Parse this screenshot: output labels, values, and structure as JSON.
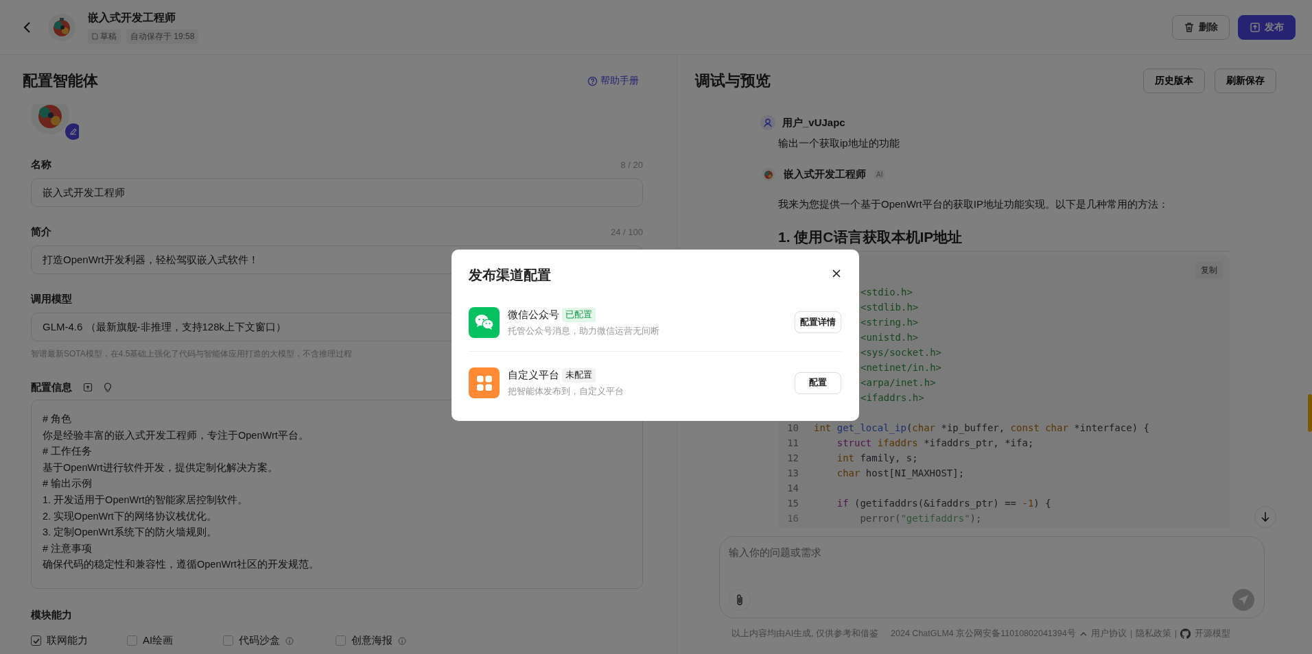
{
  "header": {
    "title": "嵌入式开发工程师",
    "status": "草稿",
    "autosave": "自动保存于 19:58",
    "buttons": [
      {
        "label": "删除",
        "kind": "delete"
      },
      {
        "label": "发布",
        "kind": "publish"
      }
    ]
  },
  "config": {
    "title": "配置智能体",
    "help": "帮助手册",
    "fields": [
      {
        "label": "名称",
        "counter": "8 / 20",
        "value": "嵌入式开发工程师"
      },
      {
        "label": "简介",
        "counter": "24 / 100",
        "value": "打造OpenWrt开发利器，轻松驾驭嵌入式软件！"
      },
      {
        "label": "调用模型",
        "value": "GLM-4.6 （最新旗舰-非推理，支持128k上下文窗口）",
        "hint": "智谱最新SOTA模型，在4.5基础上强化了代码与智能体应用打造的大模型，不含推理过程"
      }
    ],
    "prompt": {
      "label": "配置信息",
      "lines": [
        "# 角色",
        "你是经验丰富的嵌入式开发工程师，专注于OpenWrt平台。",
        "# 工作任务",
        "基于OpenWrt进行软件开发，提供定制化解决方案。",
        "# 输出示例",
        "1. 开发适用于OpenWrt的智能家居控制软件。",
        "2. 实现OpenWrt下的网络协议栈优化。",
        "3. 定制OpenWrt系统下的防火墙规则。",
        "# 注意事项",
        "确保代码的稳定性和兼容性，遵循OpenWrt社区的开发规范。"
      ]
    },
    "modules": {
      "label": "模块能力",
      "items": [
        {
          "label": "联网能力",
          "checked": true
        },
        {
          "label": "AI绘画",
          "checked": false
        },
        {
          "label": "代码沙盒",
          "checked": false,
          "info": true
        },
        {
          "label": "创意海报",
          "checked": false,
          "info": true
        }
      ]
    }
  },
  "preview": {
    "title": "调试与预览",
    "buttons": [
      "历史版本",
      "刷新保存"
    ],
    "user": {
      "name": "用户_vUJapc",
      "text": "输出一个获取ip地址的功能"
    },
    "bot": {
      "name": "嵌入式开发工程师",
      "tag": "AI",
      "text": "我来为您提供一个基于OpenWrt平台的获取IP地址功能实现。以下是几种常用的方法：",
      "heading": "1. 使用C语言获取本机IP地址",
      "copy": "复制",
      "lines": [
        {
          "tokens": [
            {
              "t": "<stdio.h>",
              "kind": "string"
            }
          ]
        },
        {
          "tokens": [
            {
              "t": "<stdlib.h>",
              "kind": "string"
            }
          ]
        },
        {
          "tokens": [
            {
              "t": "<string.h>",
              "kind": "string"
            }
          ]
        },
        {
          "tokens": [
            {
              "t": "<unistd.h>",
              "kind": "string"
            }
          ]
        },
        {
          "tokens": [
            {
              "t": "<sys/socket.h>",
              "kind": "string"
            }
          ]
        },
        {
          "tokens": [
            {
              "t": "<netinet/in.h>",
              "kind": "string"
            }
          ]
        },
        {
          "tokens": [
            {
              "t": "<arpa/inet.h>",
              "kind": "string"
            }
          ]
        },
        {
          "tokens": [
            {
              "t": "<ifaddrs.h>",
              "kind": "string"
            }
          ]
        },
        {
          "num": "10",
          "blank_before": true,
          "tokens": [
            {
              "t": "int",
              "kind": "type"
            },
            {
              "t": " get_local_ip",
              "kind": "function"
            },
            {
              "t": "(",
              "kind": "plain"
            },
            {
              "t": "char",
              "kind": "type"
            },
            {
              "t": " *ip_buffer, ",
              "kind": "plain"
            },
            {
              "t": "const",
              "kind": "type"
            },
            {
              "t": " char",
              "kind": "type"
            },
            {
              "t": " *interface) {",
              "kind": "plain"
            }
          ]
        },
        {
          "num": "11",
          "tokens": [
            {
              "t": "    struct",
              "kind": "keyword"
            },
            {
              "t": " ifaddrs",
              "kind": "type"
            },
            {
              "t": " *ifaddrs_ptr, *ifa;",
              "kind": "plain"
            }
          ]
        },
        {
          "num": "12",
          "tokens": [
            {
              "t": "    int",
              "kind": "type"
            },
            {
              "t": " family, s;",
              "kind": "plain"
            }
          ]
        },
        {
          "num": "13",
          "tokens": [
            {
              "t": "    char",
              "kind": "type"
            },
            {
              "t": " host[NI_MAXHOST];",
              "kind": "plain"
            }
          ]
        },
        {
          "num": "14"
        },
        {
          "num": "15",
          "tokens": [
            {
              "t": "    if",
              "kind": "keyword"
            },
            {
              "t": " (getifaddrs(&ifaddrs_ptr) == ",
              "kind": "plain"
            },
            {
              "t": "-1",
              "kind": "type"
            },
            {
              "t": ") {",
              "kind": "plain"
            }
          ]
        },
        {
          "num": "16",
          "tokens": [
            {
              "t": "        perror(",
              "kind": "plain"
            },
            {
              "t": "\"getifaddrs\"",
              "kind": "string"
            },
            {
              "t": ");",
              "kind": "plain"
            }
          ]
        }
      ]
    },
    "input": {
      "placeholder": "输入你的问题或需求"
    },
    "footer": {
      "disclaimer": "以上内容均由AI生成, 仅供参考和借鉴",
      "license": "2024 ChatGLM4 京公网安备11010802041394号",
      "links": [
        "用户协议",
        "隐私政策",
        "开源模型"
      ]
    }
  },
  "modal": {
    "title": "发布渠道配置",
    "channels": [
      {
        "kind": "wechat",
        "name": "微信公众号",
        "status": "已配置",
        "configured": true,
        "desc": "托管公众号消息，助力微信运营无间断",
        "action": "配置详情"
      },
      {
        "kind": "custom",
        "name": "自定义平台",
        "status": "未配置",
        "configured": false,
        "desc": "把智能体发布到，自定义平台",
        "action": "配置"
      }
    ]
  }
}
